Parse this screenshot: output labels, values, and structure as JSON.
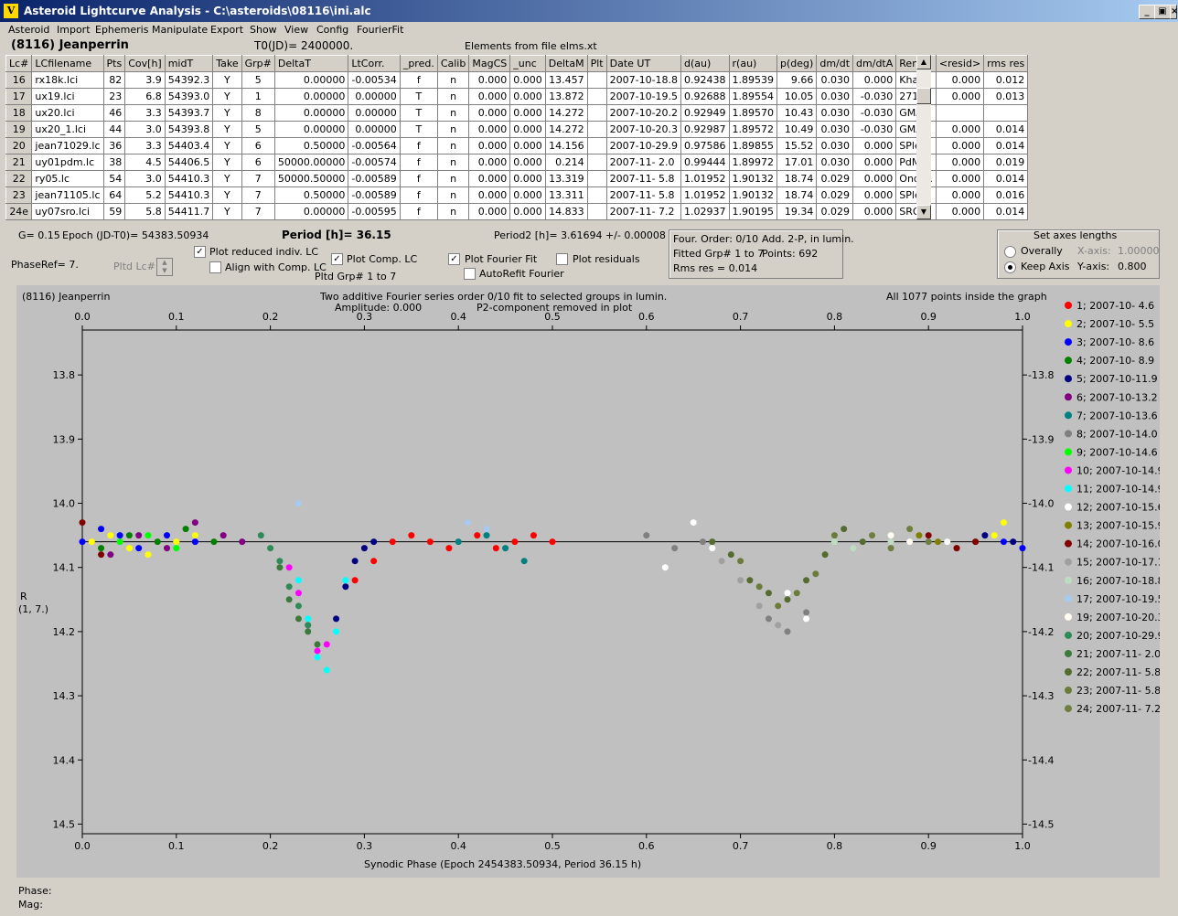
{
  "window": {
    "title": "Asteroid Lightcurve Analysis - C:\\asteroids\\08116\\ini.alc",
    "min": "_",
    "max": "▣",
    "close": "×"
  },
  "menu": [
    "Asteroid",
    "Import",
    "Ephemeris",
    "Manipulate",
    "Export",
    "Show",
    "View",
    "Config",
    "FourierFit"
  ],
  "object_name": "(8116) Jeanperrin",
  "t0": "T0(JD)= 2400000.",
  "elements_note": "Elements from file elms.xt",
  "table": {
    "headers": [
      "Lc#",
      "LCfilename",
      "Pts",
      "Cov[h]",
      "midT",
      "Take",
      "Grp#",
      "DeltaT",
      "LtCorr.",
      "_pred.",
      "Calib",
      "MagCS",
      "_unc",
      "DeltaM",
      "Plt",
      "Date UT",
      "d(au)",
      "r(au)",
      "p(deg)",
      "dm/dt",
      "dm/dtA",
      "Rem.",
      "<resid>",
      "rms res"
    ],
    "rows": [
      [
        "16",
        "rx18k.lci",
        "82",
        "3.9",
        "54392.3",
        "Y",
        "5",
        "0.00000",
        "-0.00534",
        "f",
        "n",
        "0.000",
        "0.000",
        "13.457",
        "",
        "2007-10-18.8",
        "0.92438",
        "1.89539",
        "9.66",
        "0.030",
        "0.000",
        "Khar...",
        "0.000",
        "0.012"
      ],
      [
        "17",
        "ux19.lci",
        "23",
        "6.8",
        "54393.0",
        "Y",
        "1",
        "0.00000",
        "0.00000",
        "T",
        "n",
        "0.000",
        "0.000",
        "13.872",
        "",
        "2007-10-19.5",
        "0.92688",
        "1.89554",
        "10.05",
        "0.030",
        "-0.030",
        "271",
        "0.000",
        "0.013"
      ],
      [
        "18",
        "ux20.lci",
        "46",
        "3.3",
        "54393.7",
        "Y",
        "8",
        "0.00000",
        "0.00000",
        "T",
        "n",
        "0.000",
        "0.000",
        "14.272",
        "",
        "2007-10-20.2",
        "0.92949",
        "1.89570",
        "10.43",
        "0.030",
        "-0.030",
        "GMAR",
        "",
        ""
      ],
      [
        "19",
        "ux20_1.lci",
        "44",
        "3.0",
        "54393.8",
        "Y",
        "5",
        "0.00000",
        "0.00000",
        "T",
        "n",
        "0.000",
        "0.000",
        "14.272",
        "",
        "2007-10-20.3",
        "0.92987",
        "1.89572",
        "10.49",
        "0.030",
        "-0.030",
        "GMAR",
        "0.000",
        "0.014"
      ],
      [
        "20",
        "jean71029.lc",
        "36",
        "3.3",
        "54403.4",
        "Y",
        "6",
        "0.50000",
        "-0.00564",
        "f",
        "n",
        "0.000",
        "0.000",
        "14.156",
        "",
        "2007-10-29.9",
        "0.97586",
        "1.89855",
        "15.52",
        "0.030",
        "0.000",
        "SPle...",
        "0.000",
        "0.014"
      ],
      [
        "21",
        "uy01pdm.lc",
        "38",
        "4.5",
        "54406.5",
        "Y",
        "6",
        "50000.00000",
        "-0.00574",
        "f",
        "n",
        "0.000",
        "0.000",
        "0.214",
        "",
        "2007-11- 2.0",
        "0.99444",
        "1.89972",
        "17.01",
        "0.030",
        "0.000",
        "PdM",
        "0.000",
        "0.019"
      ],
      [
        "22",
        "ry05.lc",
        "54",
        "3.0",
        "54410.3",
        "Y",
        "7",
        "50000.50000",
        "-0.00589",
        "f",
        "n",
        "0.000",
        "0.000",
        "13.319",
        "",
        "2007-11- 5.8",
        "1.01952",
        "1.90132",
        "18.74",
        "0.029",
        "0.000",
        "Ondr...",
        "0.000",
        "0.014"
      ],
      [
        "23",
        "jean71105.lc",
        "64",
        "5.2",
        "54410.3",
        "Y",
        "7",
        "0.50000",
        "-0.00589",
        "f",
        "n",
        "0.000",
        "0.000",
        "13.311",
        "",
        "2007-11- 5.8",
        "1.01952",
        "1.90132",
        "18.74",
        "0.029",
        "0.000",
        "SPle...",
        "0.000",
        "0.016"
      ],
      [
        "24e",
        "uy07sro.lci",
        "59",
        "5.8",
        "54411.7",
        "Y",
        "7",
        "0.00000",
        "-0.00595",
        "f",
        "n",
        "0.000",
        "0.000",
        "14.833",
        "",
        "2007-11- 7.2",
        "1.02937",
        "1.90195",
        "19.34",
        "0.029",
        "0.000",
        "SRO",
        "0.000",
        "0.014"
      ]
    ]
  },
  "controls": {
    "g_value": "G= 0.15",
    "epoch": "Epoch (JD-T0)= 54383.50934",
    "period": "Period [h]= 36.15",
    "period2": "Period2 [h]= 3.61694 +/- 0.00008",
    "phaseref": "PhaseRef= 7.",
    "pltd_lc": "Pltd Lc#:",
    "plot_reduced": "Plot reduced indiv. LC",
    "align_comp": "Align with Comp. LC",
    "plot_comp": "Plot Comp. LC",
    "pltd_grp": "Pltd Grp#  1   to   7",
    "plot_fourier": "Plot Fourier Fit",
    "autorefit": "AutoRefit Fourier",
    "plot_residuals": "Plot residuals",
    "fourier_order": "Four. Order:  0/10",
    "add_2p": "Add. 2-P, in lumin.",
    "fitted_grp": "Fitted Grp# 1 to 7",
    "points": "Points: 692",
    "rms_res": "Rms res      = 0.014",
    "axes_title": "Set axes lengths",
    "overally": "Overally",
    "keep_axis": "Keep Axis",
    "x_axis_label": "X-axis:",
    "x_axis_val": "1.00000",
    "y_axis_label": "Y-axis:",
    "y_axis_val": "0.800"
  },
  "plot": {
    "name": "(8116) Jeanperrin",
    "subtitle1": "Two additive Fourier series order 0/10 fit to selected groups in lumin.",
    "subtitle2": "Amplitude: 0.000",
    "subtitle3": "P2-component removed in plot",
    "inside_note": "All 1077 points inside the graph",
    "ylabel1": "R",
    "ylabel2": "(1, 7.)",
    "xlabel": "Synodic Phase (Epoch 2454383.50934, Period 36.15 h)",
    "phase_label": "Phase:",
    "mag_label": "Mag:"
  },
  "chart_data": {
    "type": "scatter",
    "xlim": [
      0.0,
      1.0
    ],
    "ylim": [
      14.5,
      13.7
    ],
    "inverted_y": true,
    "xticks": [
      0.0,
      0.1,
      0.2,
      0.3,
      0.4,
      0.5,
      0.6,
      0.7,
      0.8,
      0.9,
      1.0
    ],
    "yticks": [
      13.8,
      13.9,
      14.0,
      14.1,
      14.2,
      14.3,
      14.4,
      14.5
    ],
    "fit_line_y": 14.06,
    "legend": [
      {
        "label": "1; 2007-10- 4.6",
        "color": "#ff0000"
      },
      {
        "label": "2; 2007-10- 5.5",
        "color": "#ffff00"
      },
      {
        "label": "3; 2007-10- 8.6",
        "color": "#0000ff"
      },
      {
        "label": "4; 2007-10- 8.9",
        "color": "#008000"
      },
      {
        "label": "5; 2007-10-11.9",
        "color": "#000080"
      },
      {
        "label": "6; 2007-10-13.2",
        "color": "#800080"
      },
      {
        "label": "7; 2007-10-13.6",
        "color": "#008080"
      },
      {
        "label": "8; 2007-10-14.0",
        "color": "#808080"
      },
      {
        "label": "9; 2007-10-14.6",
        "color": "#00ff00"
      },
      {
        "label": "10; 2007-10-14.9",
        "color": "#ff00ff"
      },
      {
        "label": "11; 2007-10-14.9",
        "color": "#00ffff"
      },
      {
        "label": "12; 2007-10-15.6",
        "color": "#ffffff"
      },
      {
        "label": "13; 2007-10-15.9",
        "color": "#808000"
      },
      {
        "label": "14; 2007-10-16.0",
        "color": "#800000"
      },
      {
        "label": "15; 2007-10-17.1",
        "color": "#a0a0a0"
      },
      {
        "label": "16; 2007-10-18.8",
        "color": "#c0dcc0"
      },
      {
        "label": "17; 2007-10-19.5",
        "color": "#a6caf0"
      },
      {
        "label": "19; 2007-10-20.3",
        "color": "#fffbf0"
      },
      {
        "label": "20; 2007-10-29.9",
        "color": "#2e8b57"
      },
      {
        "label": "21; 2007-11- 2.0",
        "color": "#3c7a3c"
      },
      {
        "label": "22; 2007-11- 5.8",
        "color": "#556b2f"
      },
      {
        "label": "23; 2007-11- 5.8",
        "color": "#6b7b3a"
      },
      {
        "label": "24; 2007-11- 7.2",
        "color": "#6f7f42"
      }
    ],
    "series": [
      {
        "name": "1; 2007-10- 4.6",
        "color": "#ff0000",
        "x": [
          0.29,
          0.31,
          0.33,
          0.35,
          0.37,
          0.39,
          0.42,
          0.44,
          0.46,
          0.48,
          0.5
        ],
        "y": [
          14.12,
          14.09,
          14.06,
          14.05,
          14.06,
          14.07,
          14.05,
          14.07,
          14.06,
          14.05,
          14.06
        ]
      },
      {
        "name": "2; 2007-10- 5.5",
        "color": "#ffff00",
        "x": [
          0.01,
          0.03,
          0.05,
          0.07,
          0.1,
          0.12,
          0.97,
          0.98
        ],
        "y": [
          14.06,
          14.05,
          14.07,
          14.08,
          14.06,
          14.05,
          14.05,
          14.03
        ]
      },
      {
        "name": "3; 2007-10- 8.6",
        "color": "#0000ff",
        "x": [
          0.0,
          0.02,
          0.04,
          0.06,
          0.09,
          0.12,
          0.98,
          1.0
        ],
        "y": [
          14.06,
          14.04,
          14.05,
          14.07,
          14.05,
          14.06,
          14.06,
          14.07
        ]
      },
      {
        "name": "4; 2007-10- 8.9",
        "color": "#008000",
        "x": [
          0.02,
          0.05,
          0.08,
          0.11,
          0.14
        ],
        "y": [
          14.07,
          14.05,
          14.06,
          14.04,
          14.06
        ]
      },
      {
        "name": "5; 2007-10-11.9",
        "color": "#000080",
        "x": [
          0.27,
          0.28,
          0.29,
          0.3,
          0.31,
          0.96,
          0.99
        ],
        "y": [
          14.18,
          14.13,
          14.09,
          14.07,
          14.06,
          14.05,
          14.06
        ]
      },
      {
        "name": "6; 2007-10-13.2",
        "color": "#800080",
        "x": [
          0.03,
          0.06,
          0.09,
          0.12,
          0.15,
          0.17
        ],
        "y": [
          14.08,
          14.05,
          14.07,
          14.03,
          14.05,
          14.06
        ]
      },
      {
        "name": "7; 2007-10-13.6",
        "color": "#008080",
        "x": [
          0.4,
          0.43,
          0.45,
          0.47
        ],
        "y": [
          14.06,
          14.05,
          14.07,
          14.09
        ]
      },
      {
        "name": "8; 2007-10-14.0",
        "color": "#808080",
        "x": [
          0.6,
          0.63,
          0.66,
          0.73,
          0.75,
          0.77
        ],
        "y": [
          14.05,
          14.07,
          14.06,
          14.18,
          14.2,
          14.17
        ]
      },
      {
        "name": "9; 2007-10-14.6",
        "color": "#00ff00",
        "x": [
          0.04,
          0.07,
          0.1
        ],
        "y": [
          14.06,
          14.05,
          14.07
        ]
      },
      {
        "name": "10; 2007-10-14.9",
        "color": "#ff00ff",
        "x": [
          0.22,
          0.23,
          0.24,
          0.25,
          0.26
        ],
        "y": [
          14.1,
          14.14,
          14.19,
          14.23,
          14.22
        ]
      },
      {
        "name": "11; 2007-10-14.9",
        "color": "#00ffff",
        "x": [
          0.23,
          0.24,
          0.25,
          0.26,
          0.27,
          0.28
        ],
        "y": [
          14.12,
          14.18,
          14.24,
          14.26,
          14.2,
          14.12
        ]
      },
      {
        "name": "12; 2007-10-15.6",
        "color": "#ffffff",
        "x": [
          0.62,
          0.65,
          0.67,
          0.75,
          0.77,
          0.9,
          0.92
        ],
        "y": [
          14.1,
          14.03,
          14.07,
          14.14,
          14.18,
          14.05,
          14.06
        ]
      },
      {
        "name": "13; 2007-10-15.9",
        "color": "#808000",
        "x": [
          0.89,
          0.91,
          0.93,
          0.95
        ],
        "y": [
          14.05,
          14.06,
          14.07,
          14.06
        ]
      },
      {
        "name": "14; 2007-10-16.0",
        "color": "#800000",
        "x": [
          0.0,
          0.02,
          0.9,
          0.93,
          0.95
        ],
        "y": [
          14.03,
          14.08,
          14.05,
          14.07,
          14.06
        ]
      },
      {
        "name": "15; 2007-10-17.1",
        "color": "#a0a0a0",
        "x": [
          0.68,
          0.7,
          0.72,
          0.74
        ],
        "y": [
          14.09,
          14.12,
          14.16,
          14.19
        ]
      },
      {
        "name": "16; 2007-10-18.8",
        "color": "#c0dcc0",
        "x": [
          0.8,
          0.82,
          0.84,
          0.86
        ],
        "y": [
          14.06,
          14.07,
          14.05,
          14.06
        ]
      },
      {
        "name": "17; 2007-10-19.5",
        "color": "#a6caf0",
        "x": [
          0.23,
          0.41,
          0.43
        ],
        "y": [
          14.0,
          14.03,
          14.04
        ]
      },
      {
        "name": "19; 2007-10-20.3",
        "color": "#fffbf0",
        "x": [
          0.86,
          0.88
        ],
        "y": [
          14.05,
          14.06
        ]
      },
      {
        "name": "20; 2007-10-29.9",
        "color": "#2e8b57",
        "x": [
          0.19,
          0.2,
          0.21,
          0.22,
          0.23,
          0.24
        ],
        "y": [
          14.05,
          14.07,
          14.09,
          14.13,
          14.16,
          14.19
        ]
      },
      {
        "name": "21; 2007-11- 2.0",
        "color": "#3c7a3c",
        "x": [
          0.21,
          0.22,
          0.23,
          0.24,
          0.25
        ],
        "y": [
          14.1,
          14.15,
          14.18,
          14.2,
          14.22
        ]
      },
      {
        "name": "22; 2007-11- 5.8",
        "color": "#556b2f",
        "x": [
          0.67,
          0.69,
          0.71,
          0.73,
          0.75,
          0.77,
          0.79,
          0.81,
          0.83
        ],
        "y": [
          14.06,
          14.08,
          14.12,
          14.14,
          14.15,
          14.12,
          14.08,
          14.04,
          14.06
        ]
      },
      {
        "name": "23; 2007-11- 5.8",
        "color": "#6b7b3a",
        "x": [
          0.7,
          0.72,
          0.74,
          0.76,
          0.78,
          0.8
        ],
        "y": [
          14.09,
          14.13,
          14.16,
          14.14,
          14.11,
          14.05
        ]
      },
      {
        "name": "24; 2007-11- 7.2",
        "color": "#6f7f42",
        "x": [
          0.84,
          0.86,
          0.88,
          0.9
        ],
        "y": [
          14.05,
          14.07,
          14.04,
          14.06
        ]
      }
    ]
  }
}
